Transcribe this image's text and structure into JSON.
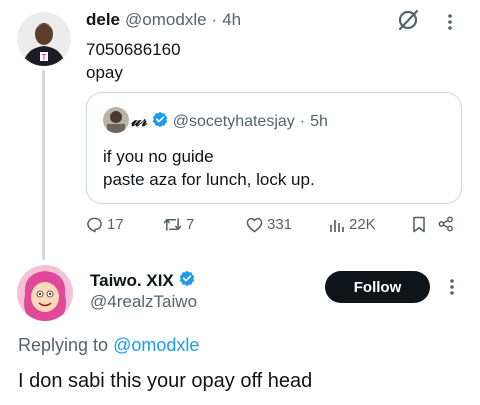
{
  "colors": {
    "verified": "#1d9bf0",
    "follow_bg": "#0f1419",
    "muted": "#536471",
    "border": "#cfd9de"
  },
  "tweet": {
    "author_name": "dele",
    "author_handle": "@omodxle",
    "separator": "·",
    "time": "4h",
    "text_lines": [
      "7050686160",
      "opay"
    ],
    "icons": {
      "grok": "grok-icon",
      "more": "more-icon"
    }
  },
  "quoted_tweet": {
    "author_name": "𝓊𝓇",
    "verified": true,
    "author_handle": "@socetyhatesjay",
    "separator": "·",
    "time": "5h",
    "text_lines": [
      "if you no guide",
      "paste aza for lunch, lock up."
    ]
  },
  "actions": {
    "replies": "17",
    "retweets": "7",
    "likes": "331",
    "views": "22K"
  },
  "reply": {
    "author_name": "Taiwo. XIX",
    "verified": true,
    "author_handle": "@4realzTaiwo",
    "follow_label": "Follow",
    "replying_prefix": "Replying to",
    "replying_handle": "@omodxle",
    "text": "I don sabi this your opay off head"
  }
}
